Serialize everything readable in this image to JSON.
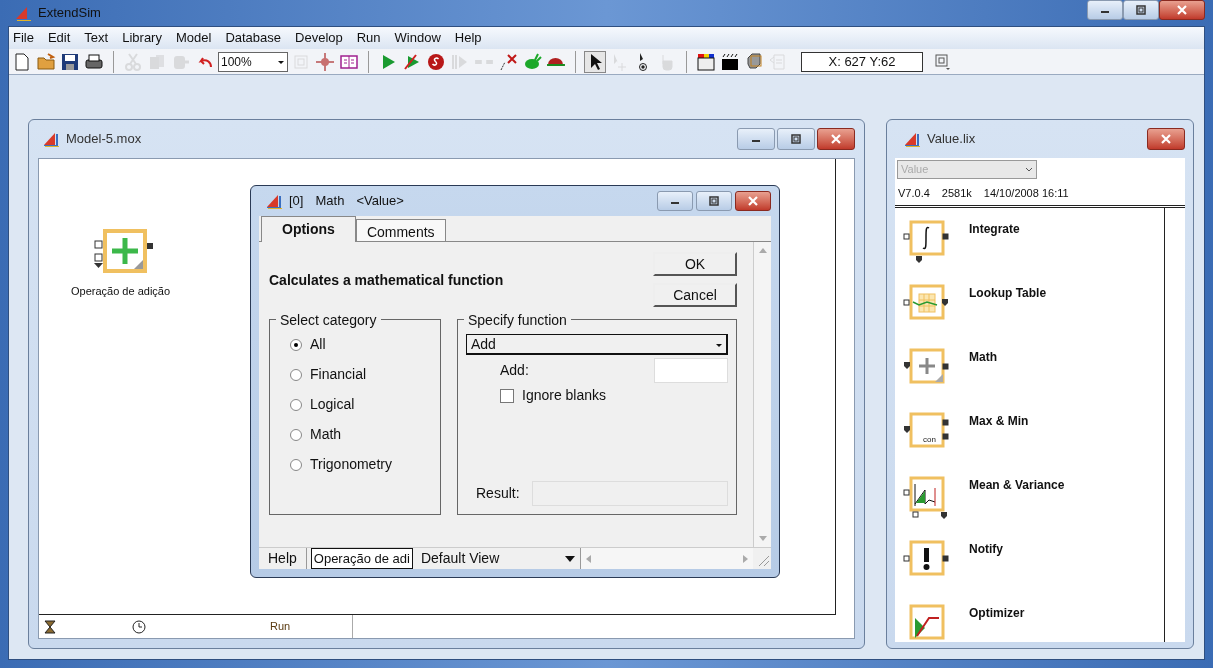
{
  "window": {
    "title": "ExtendSim"
  },
  "menu": [
    "File",
    "Edit",
    "Text",
    "Library",
    "Model",
    "Database",
    "Develop",
    "Run",
    "Window",
    "Help"
  ],
  "toolbar": [
    {
      "kind": "new",
      "disabled": false
    },
    {
      "kind": "open",
      "disabled": false
    },
    {
      "kind": "save",
      "disabled": false
    },
    {
      "kind": "print",
      "disabled": false
    },
    {
      "kind": "sep"
    },
    {
      "kind": "cut",
      "disabled": true
    },
    {
      "kind": "copy",
      "disabled": true
    },
    {
      "kind": "paste",
      "disabled": true
    },
    {
      "kind": "undo",
      "disabled": false
    },
    {
      "kind": "zoom",
      "value": "100%"
    },
    {
      "kind": "frame",
      "disabled": true
    },
    {
      "kind": "target",
      "disabled": false
    },
    {
      "kind": "book",
      "disabled": false
    },
    {
      "kind": "sep"
    },
    {
      "kind": "play",
      "disabled": false
    },
    {
      "kind": "step",
      "disabled": false
    },
    {
      "kind": "stop",
      "disabled": false
    },
    {
      "kind": "pause",
      "disabled": true
    },
    {
      "kind": "link",
      "disabled": true
    },
    {
      "kind": "cross",
      "disabled": false
    },
    {
      "kind": "rabbit",
      "disabled": false
    },
    {
      "kind": "turtle",
      "disabled": false
    },
    {
      "kind": "sep"
    },
    {
      "kind": "pointer",
      "disabled": false,
      "selected": true
    },
    {
      "kind": "pointer-plus",
      "disabled": true,
      "selected": false
    },
    {
      "kind": "pointer-dot",
      "disabled": false,
      "selected": false
    },
    {
      "kind": "hand",
      "disabled": true,
      "selected": false
    },
    {
      "kind": "sep"
    },
    {
      "kind": "colors",
      "disabled": false
    },
    {
      "kind": "pattern",
      "disabled": false
    },
    {
      "kind": "shape",
      "disabled": false
    },
    {
      "kind": "layers",
      "disabled": true
    },
    {
      "kind": "coords",
      "value": "X: 627 Y:62"
    },
    {
      "kind": "view",
      "disabled": false
    }
  ],
  "model_window": {
    "title": "Model-5.mox",
    "block_label": "Operação de adição",
    "status": "Run"
  },
  "dialog": {
    "title_index": "[0]",
    "title_name": "Math",
    "title_library": "<Value>",
    "tabs": [
      {
        "label": "Options",
        "selected": true
      },
      {
        "label": "Comments",
        "selected": false
      }
    ],
    "description": "Calculates a mathematical function",
    "buttons": [
      "OK",
      "Cancel"
    ],
    "category_group": "Select category",
    "categories": [
      {
        "label": "All",
        "selected": true
      },
      {
        "label": "Financial",
        "selected": false
      },
      {
        "label": "Logical",
        "selected": false
      },
      {
        "label": "Math",
        "selected": false
      },
      {
        "label": "Trigonometry",
        "selected": false
      }
    ],
    "function_group": "Specify function",
    "function_value": "Add",
    "add_label": "Add:",
    "ignore_blanks": {
      "label": "Ignore blanks",
      "checked": false
    },
    "result_label": "Result:",
    "bottom": {
      "help": "Help",
      "block_name": "Operação de adi",
      "view": "Default View"
    }
  },
  "library_window": {
    "title": "Value.lix",
    "library_select": "Value",
    "version": "V7.0.4",
    "size": "2581k",
    "date": "14/10/2008 16:11",
    "blocks": [
      {
        "kind": "integrate",
        "name": "Integrate"
      },
      {
        "kind": "lookup",
        "name": "Lookup Table"
      },
      {
        "kind": "math",
        "name": "Math"
      },
      {
        "kind": "maxmin",
        "name": "Max & Min",
        "icon_text": "con"
      },
      {
        "kind": "meanvar",
        "name": "Mean & Variance"
      },
      {
        "kind": "notify",
        "name": "Notify"
      },
      {
        "kind": "optimizer",
        "name": "Optimizer"
      }
    ]
  }
}
